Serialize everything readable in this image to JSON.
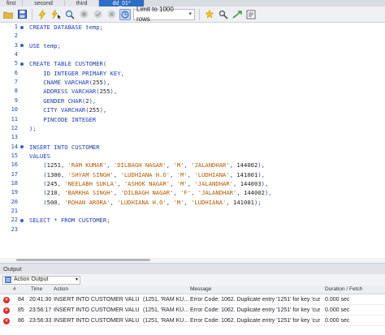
{
  "tabs": [
    {
      "label": "first",
      "active": false
    },
    {
      "label": "second",
      "active": false
    },
    {
      "label": "third",
      "active": false
    },
    {
      "label": "dd_01*",
      "active": true
    }
  ],
  "toolbar": {
    "limit_label": "Limit to 1000 rows",
    "icons": [
      "open-folder-icon",
      "save-icon",
      "lightning-execute-icon",
      "lightning-cursor-icon",
      "magnifier-explain-icon",
      "stop-icon",
      "commit-check-icon",
      "rollback-icon",
      "toggle-autocommit-icon",
      "beautify-icon",
      "find-icon",
      "invisible-chars-icon",
      "wrap-icon"
    ]
  },
  "editor": {
    "lines": [
      {
        "n": "1",
        "dot": true,
        "text": "CREATE DATABASE temp;"
      },
      {
        "n": "2",
        "dot": false,
        "text": ""
      },
      {
        "n": "3",
        "dot": true,
        "text": "USE temp;"
      },
      {
        "n": "4",
        "dot": false,
        "text": ""
      },
      {
        "n": "5",
        "dot": true,
        "text": "CREATE TABLE CUSTOMER("
      },
      {
        "n": "6",
        "dot": false,
        "text": "    ID INTEGER PRIMARY KEY,"
      },
      {
        "n": "7",
        "dot": false,
        "text": "    CNAME VARCHAR(255),"
      },
      {
        "n": "8",
        "dot": false,
        "text": "    ADDRESS VARCHAR(255),"
      },
      {
        "n": "9",
        "dot": false,
        "text": "    GENDER CHAR(2),"
      },
      {
        "n": "10",
        "dot": false,
        "text": "    CITY VARCHAR(255),"
      },
      {
        "n": "11",
        "dot": false,
        "text": "    PINCODE INTEGER"
      },
      {
        "n": "12",
        "dot": false,
        "text": ");"
      },
      {
        "n": "13",
        "dot": false,
        "text": ""
      },
      {
        "n": "14",
        "dot": true,
        "text": "INSERT INTO CUSTOMER"
      },
      {
        "n": "15",
        "dot": false,
        "text": "VALUES"
      },
      {
        "n": "16",
        "dot": false,
        "text": "    (1251, 'RAM KUMAR', 'DILBAGH NAGAR', 'M', 'JALANDHAR', 144002),"
      },
      {
        "n": "17",
        "dot": false,
        "text": "    (1300, 'SHYAM SINGH', 'LUDHIANA H.O', 'M', 'LUDHIANA', 141001),"
      },
      {
        "n": "18",
        "dot": false,
        "text": "    (245, 'NEELABH SUKLA', 'ASHOK NAGAR', 'M', 'JALANDHAR', 144003),"
      },
      {
        "n": "19",
        "dot": false,
        "text": "    (210, 'BARKHA SINGH', 'DILBAGH NAGAR', 'F', 'JALANDHAR', 144002),"
      },
      {
        "n": "20",
        "dot": false,
        "text": "    (500, 'ROHAN ARORA', 'LUDHIANA H.O', 'M', 'LUDHIANA', 141001);"
      },
      {
        "n": "21",
        "dot": false,
        "text": ""
      },
      {
        "n": "22",
        "dot": true,
        "text": "SELECT * FROM CUSTOMER;"
      },
      {
        "n": "23",
        "dot": false,
        "text": ""
      }
    ]
  },
  "output": {
    "title": "Output",
    "selector": "Action Output",
    "columns": [
      "#",
      "Time",
      "Action",
      "Message",
      "Duration / Fetch"
    ],
    "rows": [
      {
        "num": "84",
        "time": "20:41:30",
        "action": "INSERT INTO CUSTOMER  VALUES",
        "action2": "(1251, 'RAM KU...",
        "message": "Error Code: 1062. Duplicate entry '1251' for key 'customer.P...",
        "duration": "0.000 sec",
        "status": "error"
      },
      {
        "num": "85",
        "time": "23:56:17",
        "action": "INSERT INTO CUSTOMER  VALUES",
        "action2": "(1251, 'RAM KU...",
        "message": "Error Code: 1062. Duplicate entry '1251' for key 'customer.P...",
        "duration": "0.000 sec",
        "status": "error"
      },
      {
        "num": "86",
        "time": "23:56:33",
        "action": "INSERT INTO CUSTOMER  VALUES",
        "action2": "(1251, 'RAM KU...",
        "message": "Error Code: 1062. Duplicate entry '1251' for key 'customer.P...",
        "duration": "0.000 sec",
        "status": "error"
      }
    ]
  },
  "colors": {
    "accent": "#2f6cc4",
    "keyword": "#1d3fb8",
    "string": "#b05a00",
    "error": "#d9302c"
  }
}
